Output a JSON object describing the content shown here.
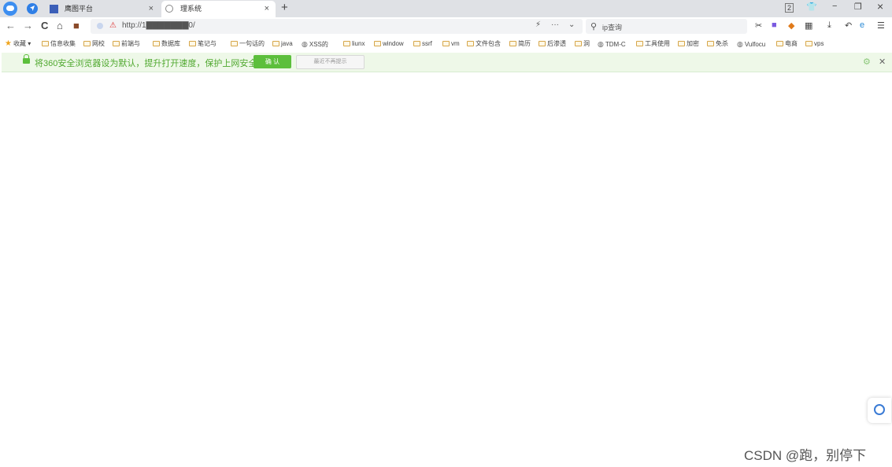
{
  "tabs": [
    {
      "title": "鹰图平台",
      "close": "×"
    },
    {
      "title": "理系统",
      "close": "×"
    }
  ],
  "newtab": "+",
  "window": {
    "badge": "2",
    "minimize": "−",
    "restore": "❐",
    "close": "×"
  },
  "toolbar": {
    "back": "←",
    "forward": "→",
    "reload": "C",
    "home": "⌂",
    "url": "http://1▇▇▇▇▇▇▇0/",
    "more": "···",
    "search_placeholder": "ip查询"
  },
  "bookmarks": [
    {
      "label": "收藏",
      "type": "star"
    },
    {
      "label": "信息收集",
      "type": "folder"
    },
    {
      "label": "网校",
      "type": "folder"
    },
    {
      "label": "前端与",
      "type": "folder"
    },
    {
      "label": "数据库",
      "type": "folder"
    },
    {
      "label": "笔记与",
      "type": "folder"
    },
    {
      "label": "一句话的",
      "type": "folder"
    },
    {
      "label": "java",
      "type": "folder"
    },
    {
      "label": "XSS的",
      "type": "globe"
    },
    {
      "label": "liunx",
      "type": "folder"
    },
    {
      "label": "window",
      "type": "folder"
    },
    {
      "label": "ssrf",
      "type": "folder"
    },
    {
      "label": "vm",
      "type": "folder"
    },
    {
      "label": "文件包含",
      "type": "folder"
    },
    {
      "label": "简历",
      "type": "folder"
    },
    {
      "label": "后渗透",
      "type": "folder"
    },
    {
      "label": "洞",
      "type": "folder"
    },
    {
      "label": "TDM-C",
      "type": "globe"
    },
    {
      "label": "工具使用",
      "type": "folder"
    },
    {
      "label": "加密",
      "type": "folder"
    },
    {
      "label": "免杀",
      "type": "folder"
    },
    {
      "label": "Vulfocu",
      "type": "globe"
    },
    {
      "label": "电商",
      "type": "folder"
    },
    {
      "label": "vps",
      "type": "folder"
    }
  ],
  "infobar": {
    "message": "将360安全浏览器设为默认，提升打开速度，保护上网安全",
    "confirm": "确 认",
    "dismiss": "最近不再提示"
  },
  "watermark": "CSDN @跑，别停下"
}
